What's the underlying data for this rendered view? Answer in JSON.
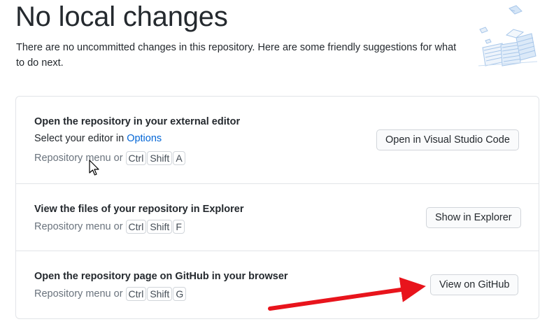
{
  "header": {
    "title": "No local changes",
    "subtitle": "There are no uncommitted changes in this repository. Here are some friendly suggestions for what to do next."
  },
  "suggestions": [
    {
      "title": "Open the repository in your external editor",
      "desc_prefix": "Select your editor in ",
      "desc_link": "Options",
      "menu_text": "Repository menu or",
      "keys": [
        "Ctrl",
        "Shift",
        "A"
      ],
      "button": "Open in Visual Studio Code"
    },
    {
      "title": "View the files of your repository in Explorer",
      "menu_text": "Repository menu or",
      "keys": [
        "Ctrl",
        "Shift",
        "F"
      ],
      "button": "Show in Explorer"
    },
    {
      "title": "Open the repository page on GitHub in your browser",
      "menu_text": "Repository menu or",
      "keys": [
        "Ctrl",
        "Shift",
        "G"
      ],
      "button": "View on GitHub"
    }
  ],
  "colors": {
    "link": "#0366d6",
    "annotation_arrow": "#e8141c"
  },
  "icons": {
    "illustration": "paper-stacks-illustration",
    "cursor": "mouse-pointer-icon",
    "annotation": "red-arrow-annotation"
  }
}
